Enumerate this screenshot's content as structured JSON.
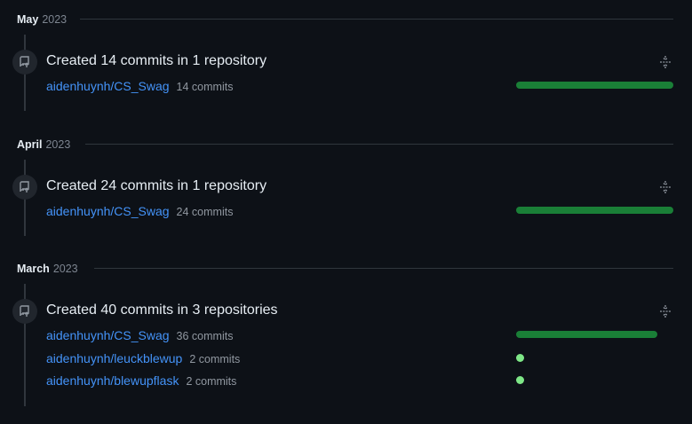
{
  "months": [
    {
      "month": "May",
      "year": "2023",
      "title": "Created 14 commits in 1 repository",
      "repos": [
        {
          "name": "aidenhuynh/CS_Swag",
          "commits": "14 commits",
          "share": 1.0
        }
      ]
    },
    {
      "month": "April",
      "year": "2023",
      "title": "Created 24 commits in 1 repository",
      "repos": [
        {
          "name": "aidenhuynh/CS_Swag",
          "commits": "24 commits",
          "share": 1.0
        }
      ]
    },
    {
      "month": "March",
      "year": "2023",
      "title": "Created 40 commits in 3 repositories",
      "repos": [
        {
          "name": "aidenhuynh/CS_Swag",
          "commits": "36 commits",
          "share": 0.9
        },
        {
          "name": "aidenhuynh/leuckblewup",
          "commits": "2 commits",
          "share": 0.05
        },
        {
          "name": "aidenhuynh/blewupflask",
          "commits": "2 commits",
          "share": 0.05
        }
      ]
    }
  ],
  "colors": {
    "bar": "#1a7f37",
    "dot": "#7ee787",
    "link": "#4493f8"
  },
  "icons": {
    "event": "repo-push-icon",
    "collapse": "fold-icon"
  }
}
